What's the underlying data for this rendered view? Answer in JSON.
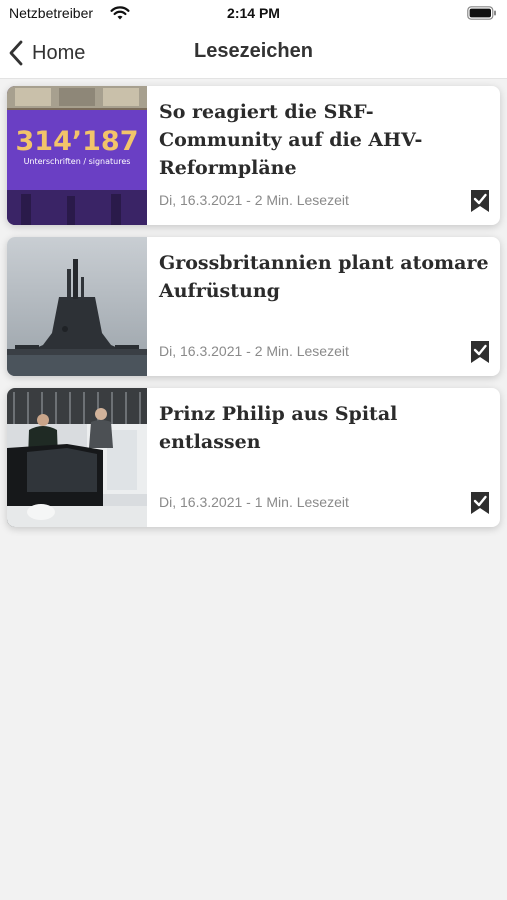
{
  "status": {
    "carrier": "Netzbetreiber",
    "time": "2:14 PM"
  },
  "nav": {
    "back_label": "Home",
    "title": "Lesezeichen"
  },
  "articles": [
    {
      "title": "So reagiert die SRF-Community auf die AHV-Reformpläne",
      "meta": "Di, 16.3.2021 - 2 Min. Lesezeit",
      "image_big": "314’187",
      "image_small": "Unterschriften / signatures"
    },
    {
      "title": "Grossbritannien plant atomare Aufrüstung",
      "meta": "Di, 16.3.2021 - 2 Min. Lesezeit"
    },
    {
      "title": "Prinz Philip aus Spital entlassen",
      "meta": "Di, 16.3.2021 - 1 Min. Lesezeit"
    }
  ],
  "icons": {
    "wifi": "wifi-icon",
    "battery": "battery-icon",
    "back": "chevron-left-icon",
    "bookmark": "bookmark-check-icon"
  }
}
